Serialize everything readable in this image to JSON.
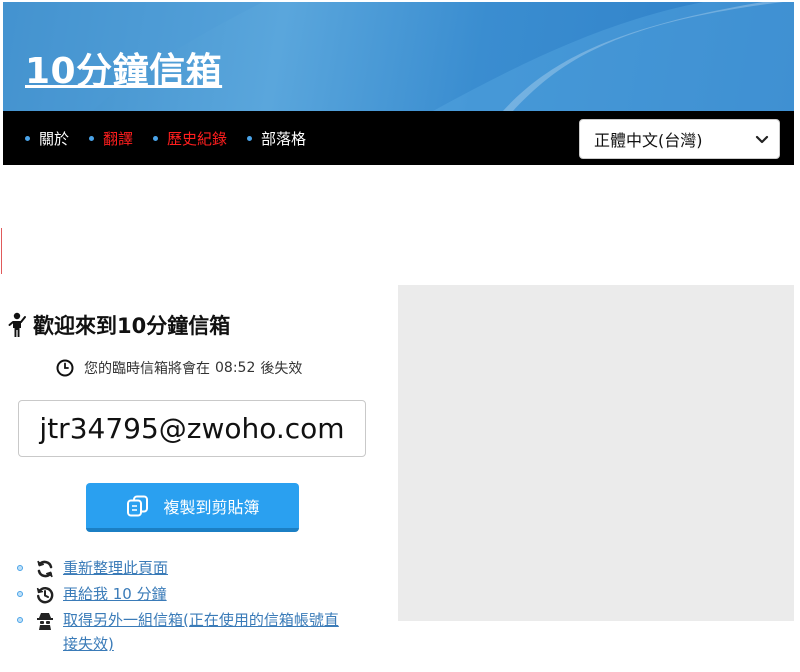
{
  "header": {
    "site_title": "10分鐘信箱"
  },
  "nav": {
    "items": [
      {
        "label": "關於",
        "color": "#ffffff"
      },
      {
        "label": "翻譯",
        "color": "#ff1e1e"
      },
      {
        "label": "歷史紀錄",
        "color": "#ff1e1e"
      },
      {
        "label": "部落格",
        "color": "#ffffff"
      }
    ],
    "language": "正體中文(台灣)"
  },
  "main": {
    "welcome_title": "歡迎來到10分鐘信箱",
    "expire_prefix": "您的臨時信箱將會在",
    "timer": "08:52",
    "expire_suffix": "後失效",
    "email": "jtr34795@zwoho.com",
    "copy_button": "複製到剪貼簿",
    "links": {
      "refresh": "重新整理此頁面",
      "extend": "再給我 10 分鐘",
      "new_mailbox": "取得另外一組信箱(正在使用的信箱帳號直接失效)"
    }
  },
  "colors": {
    "accent": "#2aa0f0",
    "header_blue": "#3f8fcb",
    "nav_bg": "#000000",
    "link": "#3a7bb8"
  }
}
